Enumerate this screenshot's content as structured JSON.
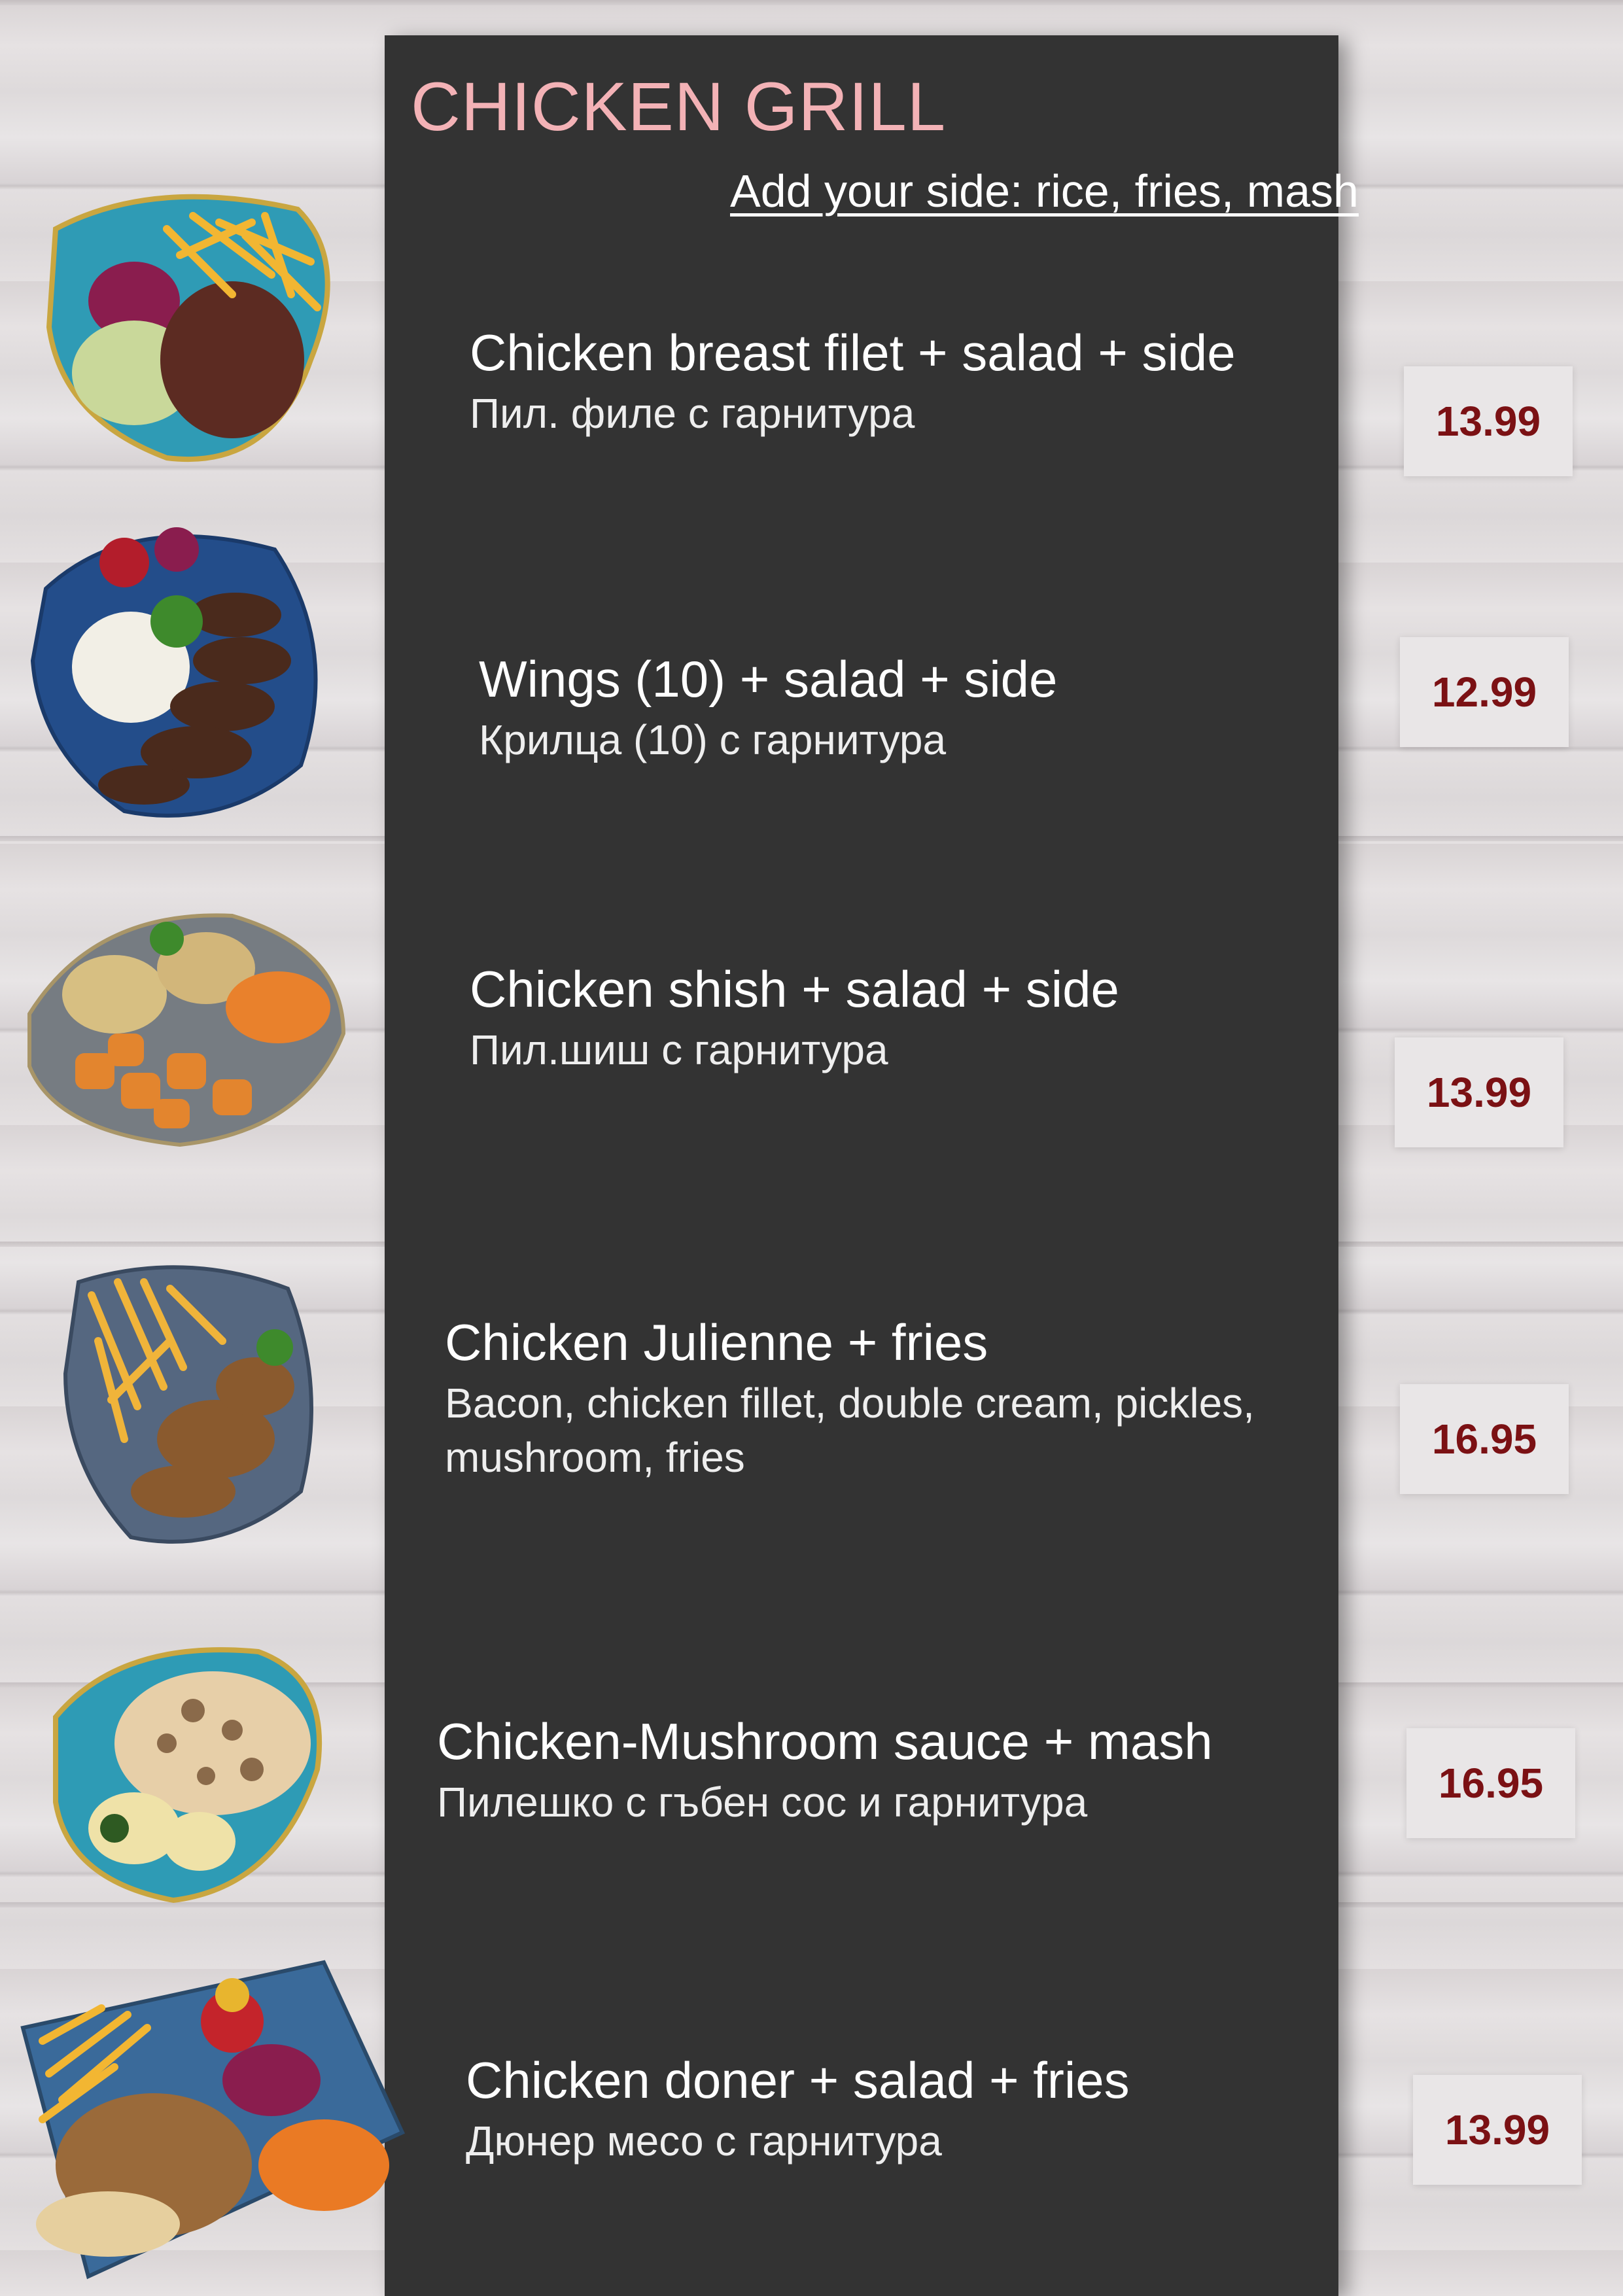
{
  "menu": {
    "title": "CHICKEN GRILL",
    "side_note": "Add your side: rice, fries, mash",
    "items": [
      {
        "name": "Chicken breast filet + salad + side",
        "desc": "Пил. филе с гарнитура",
        "price": "13.99"
      },
      {
        "name": "Wings (10) + salad + side",
        "desc": "Крилца (10) с гарнитура",
        "price": "12.99"
      },
      {
        "name": "Chicken shish + salad + side",
        "desc": "Пил.шиш с гарнитура",
        "price": "13.99"
      },
      {
        "name": "Chicken Julienne + fries",
        "desc": "Bacon, chicken fillet, double cream, pickles, mushroom, fries",
        "price": "16.95"
      },
      {
        "name": "Chicken-Mushroom sauce + mash",
        "desc": "Пилешко с гъбен сос и гарнитура",
        "price": "16.95"
      },
      {
        "name": "Chicken doner + salad + fries",
        "desc": "Дюнер месо с гарнитура",
        "price": "13.99"
      }
    ]
  },
  "colors": {
    "panel": "#333333",
    "title": "#f3b2b6",
    "price_text": "#7b1114",
    "price_box": "#e9e6e7"
  }
}
